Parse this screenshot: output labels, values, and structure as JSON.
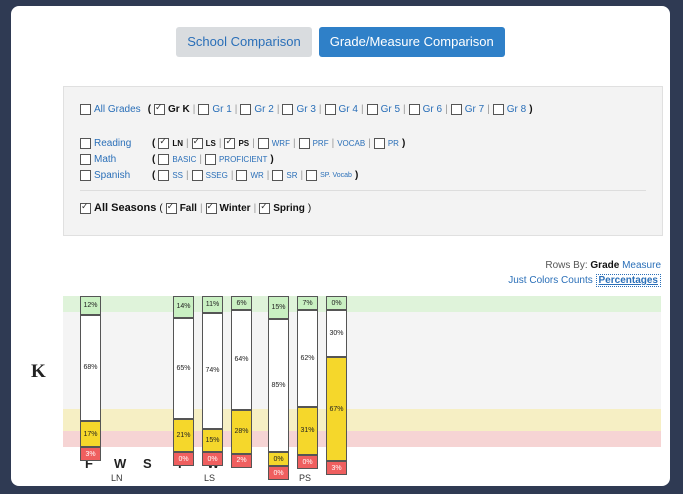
{
  "tabs": {
    "school": "School Comparison",
    "grade_measure": "Grade/Measure Comparison"
  },
  "filters": {
    "all_grades": "All Grades",
    "grades": [
      "Gr K",
      "Gr 1",
      "Gr 2",
      "Gr 3",
      "Gr 4",
      "Gr 5",
      "Gr 6",
      "Gr 7",
      "Gr 8"
    ],
    "reading": "Reading",
    "reading_measures": [
      "LN",
      "LS",
      "PS",
      "WRF",
      "PRF",
      "VOCAB",
      "PR"
    ],
    "math": "Math",
    "math_measures": [
      "BASIC",
      "PROFICIENT"
    ],
    "spanish": "Spanish",
    "spanish_measures": [
      "SS",
      "SSEG",
      "WR",
      "SR",
      "SP. Vocab"
    ],
    "all_seasons": "All Seasons",
    "seasons": [
      "Fall",
      "Winter",
      "Spring"
    ]
  },
  "rows_by": {
    "label": "Rows By:",
    "grade": "Grade",
    "measure": "Measure"
  },
  "view": {
    "just_colors": "Just Colors",
    "counts": "Counts",
    "percentages": "Percentages"
  },
  "grade_row": "K",
  "chart_data": {
    "type": "bar",
    "stacking": "percent",
    "groups": [
      {
        "name": "LN",
        "seasons": [
          {
            "season": "F",
            "green": 12,
            "white": 68,
            "yellow": 17,
            "red": 3
          },
          {
            "season": "W"
          },
          {
            "season": "S"
          }
        ]
      },
      {
        "name": "LS",
        "seasons": [
          {
            "season": "F",
            "green": 14,
            "white": 65,
            "yellow": 21,
            "red": 0
          },
          {
            "season": "W",
            "green": 11,
            "white": 74,
            "yellow": 15,
            "red": 0
          },
          {
            "season": "S",
            "green": 6,
            "white": 64,
            "yellow": 28,
            "red": 2
          }
        ]
      },
      {
        "name": "PS",
        "seasons": [
          {
            "season": "F",
            "green": 15,
            "white": 85,
            "yellow": 0,
            "red": 0
          },
          {
            "season": "W",
            "green": 7,
            "white": 62,
            "yellow": 31,
            "red": 0
          },
          {
            "season": "S",
            "green": 0,
            "white": 30,
            "yellow": 67,
            "red": 3
          }
        ]
      }
    ]
  }
}
